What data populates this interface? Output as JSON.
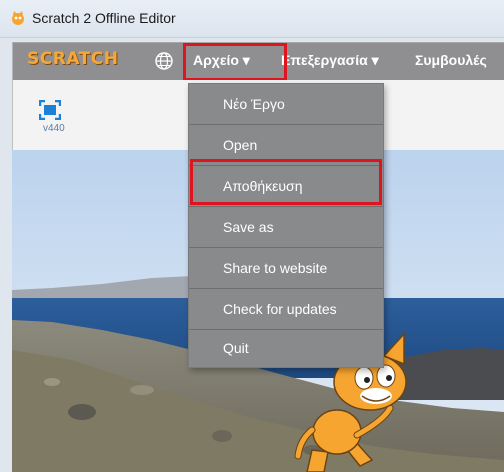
{
  "window": {
    "title": "Scratch 2 Offline Editor"
  },
  "menubar": {
    "logo": "SCRATCH",
    "globe_icon": "globe-icon",
    "file_label": "Αρχείο ▾",
    "edit_label": "Επεξεργασία ▾",
    "tips_label": "Συμβουλές"
  },
  "stage": {
    "version": "v440"
  },
  "file_menu": {
    "items": [
      {
        "label": "Νέο Έργο"
      },
      {
        "label": "Open"
      },
      {
        "label": "Αποθήκευση"
      },
      {
        "label": "Save as"
      },
      {
        "label": "Share to website"
      },
      {
        "label": "Check for updates"
      },
      {
        "label": "Quit"
      }
    ]
  },
  "colors": {
    "highlight": "#e0141e",
    "menubar": "#8f8f91",
    "dropdown": "#888a8c"
  }
}
